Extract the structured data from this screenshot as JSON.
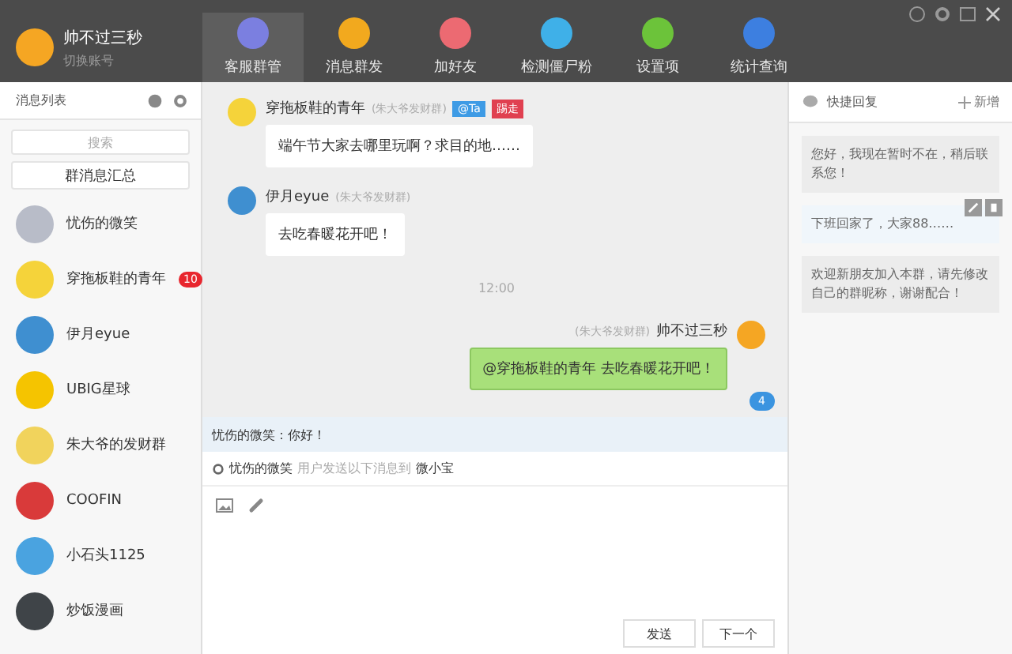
{
  "account": {
    "name": "帅不过三秒",
    "switch_label": "切换账号"
  },
  "nav": [
    {
      "label": "客服群管",
      "color": "#7b7fe0",
      "selected": true
    },
    {
      "label": "消息群发",
      "color": "#f2a91e",
      "selected": false
    },
    {
      "label": "加好友",
      "color": "#ec6a72",
      "selected": false
    },
    {
      "label": "检测僵尸粉",
      "color": "#3fb0e8",
      "selected": false
    },
    {
      "label": "设置项",
      "color": "#6cc33a",
      "selected": false
    },
    {
      "label": "统计查询",
      "color": "#3d7fe0",
      "selected": false
    }
  ],
  "sidebar": {
    "title": "消息列表",
    "search": {
      "placeholder": "搜索"
    },
    "summary_button": "群消息汇总",
    "contacts": [
      {
        "name": "忧伤的微笑",
        "color": "#b8bcc8"
      },
      {
        "name": "穿拖板鞋的青年",
        "color": "#f5d33a",
        "badge": "10"
      },
      {
        "name": "伊月eyue",
        "color": "#3f8fd0"
      },
      {
        "name": "UBIG星球",
        "color": "#f5c400"
      },
      {
        "name": "朱大爷的发财群",
        "color": "#f1d35c"
      },
      {
        "name": "COOFIN",
        "color": "#d93a3a"
      },
      {
        "name": "小石头1125",
        "color": "#4aa3e0"
      },
      {
        "name": "炒饭漫画",
        "color": "#3f4448"
      }
    ]
  },
  "chat": {
    "messages": [
      {
        "kind": "incoming",
        "sender": "穿拖板鞋的青年",
        "group": "(朱大爷发财群)",
        "at_tag": "@Ta",
        "kick_tag": "踢走",
        "text": "端午节大家去哪里玩啊？求目的地……",
        "color": "#f5d33a"
      },
      {
        "kind": "incoming",
        "sender": "伊月eyue",
        "group": "(朱大爷发财群)",
        "text": "去吃春暖花开吧！",
        "color": "#3f8fd0"
      },
      {
        "kind": "time",
        "text": "12:00"
      },
      {
        "kind": "outgoing",
        "sender": "帅不过三秒",
        "group": "(朱大爷发财群)",
        "text": "@穿拖板鞋的青年 去吃春暖花开吧！",
        "color": "#f5a623"
      }
    ],
    "unread": "4",
    "quote": "忧伤的微笑：你好！",
    "target": {
      "user": "忧伤的微笑",
      "middle": "用户发送以下消息到",
      "bot": "微小宝"
    },
    "send_button": "发送",
    "next_button": "下一个"
  },
  "quick_replies": {
    "title": "快捷回复",
    "add_label": "新增",
    "items": [
      {
        "text": "您好，我现在暂时不在，稍后联系您！",
        "selected": false
      },
      {
        "text": "下班回家了，大家88……",
        "selected": true
      },
      {
        "text": "欢迎新朋友加入本群，请先修改自己的群昵称，谢谢配合！",
        "selected": false
      }
    ]
  }
}
